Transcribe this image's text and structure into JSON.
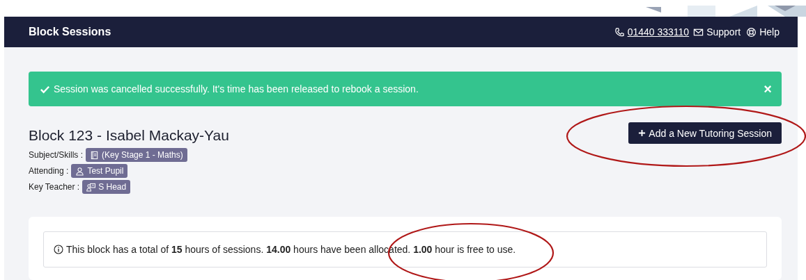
{
  "navbar": {
    "title": "Block Sessions",
    "phone": "01440 333110",
    "links": [
      {
        "kind": "mail",
        "label": "Support"
      },
      {
        "kind": "help",
        "label": "Help"
      }
    ]
  },
  "alert": {
    "message": "Session was cancelled successfully. It's time has been released to rebook a session.",
    "close": "×"
  },
  "block": {
    "title": "Block 123 - Isabel Mackay-Yau",
    "add_button": "Add a New Tutoring Session",
    "details": [
      {
        "label": "Subject/Skills :",
        "kind": "book",
        "value": "(Key Stage 1 - Maths)"
      },
      {
        "label": "Attending :",
        "kind": "person",
        "value": "Test Pupil"
      },
      {
        "label": "Key Teacher :",
        "kind": "teacher",
        "value": "S Head"
      }
    ]
  },
  "info": "This block has a total of **15** hours of sessions. **14.00** hours have been allocated. **1.00** hour is free to use."
}
